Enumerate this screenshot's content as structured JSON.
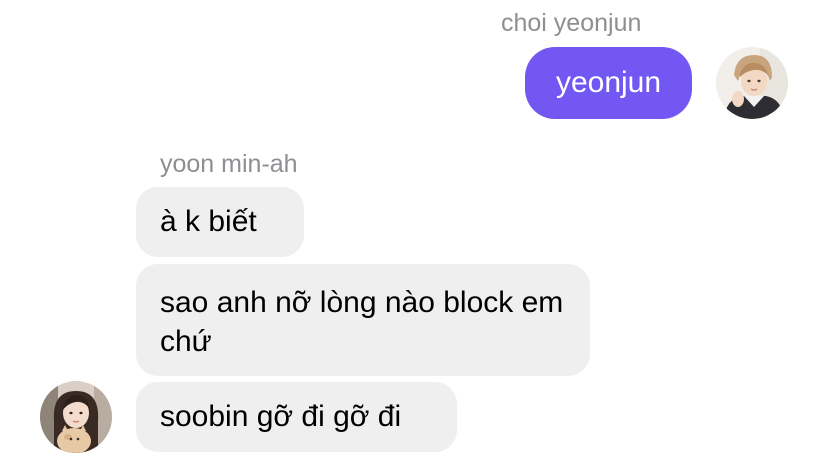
{
  "outgoing": {
    "sender": "choi yeonjun",
    "message": "yeonjun",
    "bubble_color": "#7257f2",
    "avatar_icon": "user-photo-icon"
  },
  "incoming": {
    "sender": "yoon min-ah",
    "messages": [
      "à k biết",
      "sao anh nỡ lòng nào block em chứ",
      "soobin gỡ đi gỡ đi"
    ],
    "bubble_color": "#efefef",
    "avatar_icon": "user-photo-icon"
  }
}
